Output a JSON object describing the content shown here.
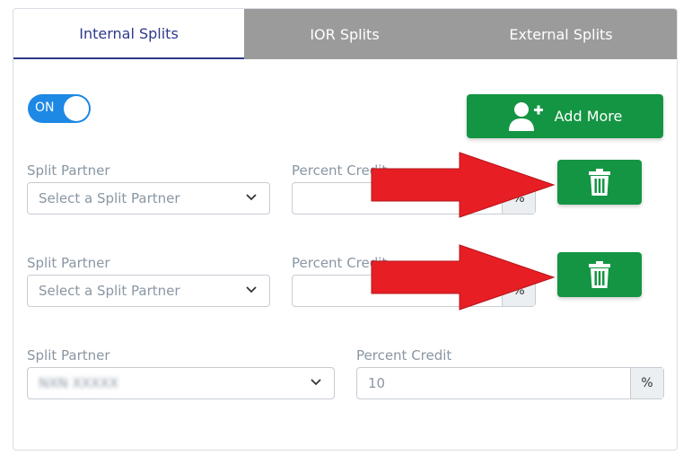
{
  "tabs": [
    {
      "label": "Internal Splits",
      "active": true
    },
    {
      "label": "IOR Splits",
      "active": false
    },
    {
      "label": "External Splits",
      "active": false
    }
  ],
  "toggle": {
    "label": "ON",
    "state": "on"
  },
  "add_button": {
    "label": "Add More",
    "icon": "add-user-icon"
  },
  "split_rows": [
    {
      "partner_label": "Split Partner",
      "partner_value": "Select a Split Partner",
      "percent_label": "Percent Credit",
      "percent_value": "",
      "percent_unit": "%",
      "delete_icon": "trash-icon"
    },
    {
      "partner_label": "Split Partner",
      "partner_value": "Select a Split Partner",
      "percent_label": "Percent Credit",
      "percent_value": "",
      "percent_unit": "%",
      "delete_icon": "trash-icon"
    },
    {
      "partner_label": "Split Partner",
      "partner_value": "NXN XXXXX",
      "percent_label": "Percent Credit",
      "percent_value": "10",
      "percent_unit": "%"
    }
  ],
  "colors": {
    "accent_green": "#149543",
    "toggle_blue": "#1e88e5",
    "tab_inactive": "#9b9b9b",
    "arrow_red": "#e81e25"
  }
}
